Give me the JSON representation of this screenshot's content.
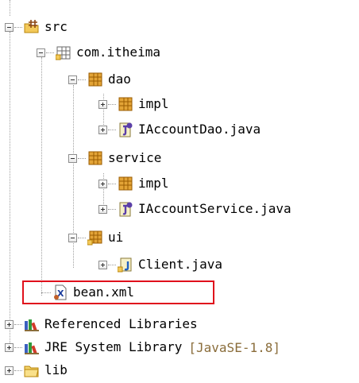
{
  "tree": {
    "items": [
      {
        "label": "src",
        "icon": "source-folder-icon",
        "expander": "minus"
      },
      {
        "label": "com.itheima",
        "icon": "package-icon",
        "expander": "minus"
      },
      {
        "label": "dao",
        "icon": "package-icon",
        "expander": "minus"
      },
      {
        "label": "impl",
        "icon": "package-icon",
        "expander": "plus"
      },
      {
        "label": "IAccountDao.java",
        "icon": "java-interface-icon",
        "expander": "plus"
      },
      {
        "label": "service",
        "icon": "package-icon",
        "expander": "minus"
      },
      {
        "label": "impl",
        "icon": "package-icon",
        "expander": "plus"
      },
      {
        "label": "IAccountService.java",
        "icon": "java-interface-icon",
        "expander": "plus"
      },
      {
        "label": "ui",
        "icon": "package-icon",
        "expander": "minus"
      },
      {
        "label": "Client.java",
        "icon": "java-class-icon",
        "expander": "plus"
      },
      {
        "label": "bean.xml",
        "icon": "xml-file-icon",
        "expander": "none"
      },
      {
        "label": "Referenced Libraries",
        "icon": "library-icon",
        "expander": "plus"
      },
      {
        "label": "JRE System Library",
        "suffix": "[JavaSE-1.8]",
        "icon": "library-icon",
        "expander": "plus"
      },
      {
        "label": "lib",
        "icon": "folder-icon",
        "expander": "plus"
      }
    ]
  },
  "colors": {
    "highlight": "#e0101c",
    "suffix": "#8a6d3b",
    "package": "#b8860b"
  }
}
